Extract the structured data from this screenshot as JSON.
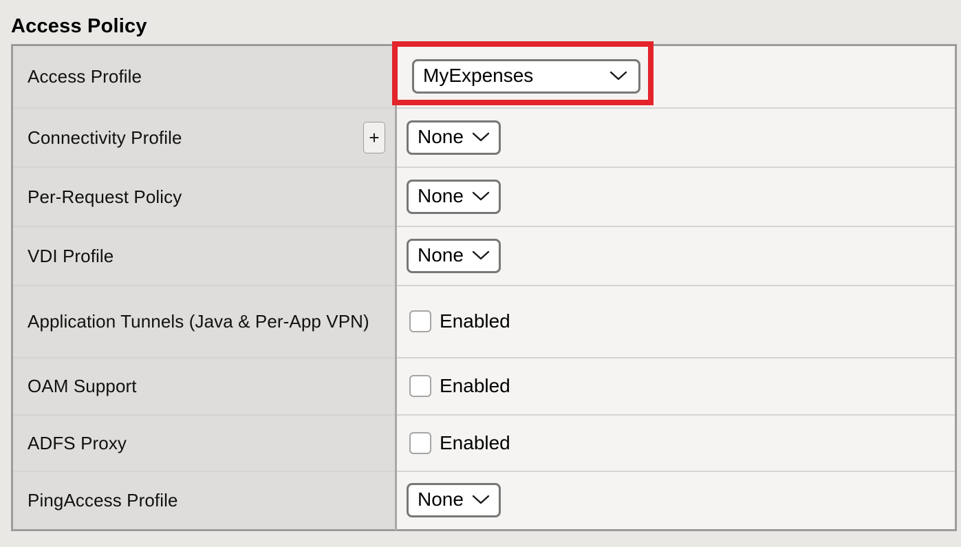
{
  "section": {
    "title": "Access Policy"
  },
  "controls": {
    "add_label": "+",
    "chevron_icon": "chevron-down-icon",
    "enabled_label": "Enabled"
  },
  "rows": [
    {
      "label": "Access Profile",
      "control": "select",
      "value": "MyExpenses",
      "has_add_button": false,
      "highlighted": true
    },
    {
      "label": "Connectivity Profile",
      "control": "select",
      "value": "None",
      "has_add_button": true,
      "highlighted": false
    },
    {
      "label": "Per-Request Policy",
      "control": "select",
      "value": "None",
      "has_add_button": false,
      "highlighted": false
    },
    {
      "label": "VDI Profile",
      "control": "select",
      "value": "None",
      "has_add_button": false,
      "highlighted": false
    },
    {
      "label": "Application Tunnels (Java & Per-App VPN)",
      "control": "checkbox",
      "value": "Enabled",
      "checked": false,
      "has_add_button": false,
      "highlighted": false
    },
    {
      "label": "OAM Support",
      "control": "checkbox",
      "value": "Enabled",
      "checked": false,
      "has_add_button": false,
      "highlighted": false
    },
    {
      "label": "ADFS Proxy",
      "control": "checkbox",
      "value": "Enabled",
      "checked": false,
      "has_add_button": false,
      "highlighted": false
    },
    {
      "label": "PingAccess Profile",
      "control": "select",
      "value": "None",
      "has_add_button": false,
      "highlighted": false
    }
  ],
  "colors": {
    "page_background": "#e9e8e5",
    "label_column": "#dedddb",
    "value_column": "#f5f4f2",
    "table_border": "#9b9b99",
    "row_divider": "#d5d4d2",
    "control_border": "#777776",
    "highlight": "#e3242b",
    "text": "#000000"
  }
}
